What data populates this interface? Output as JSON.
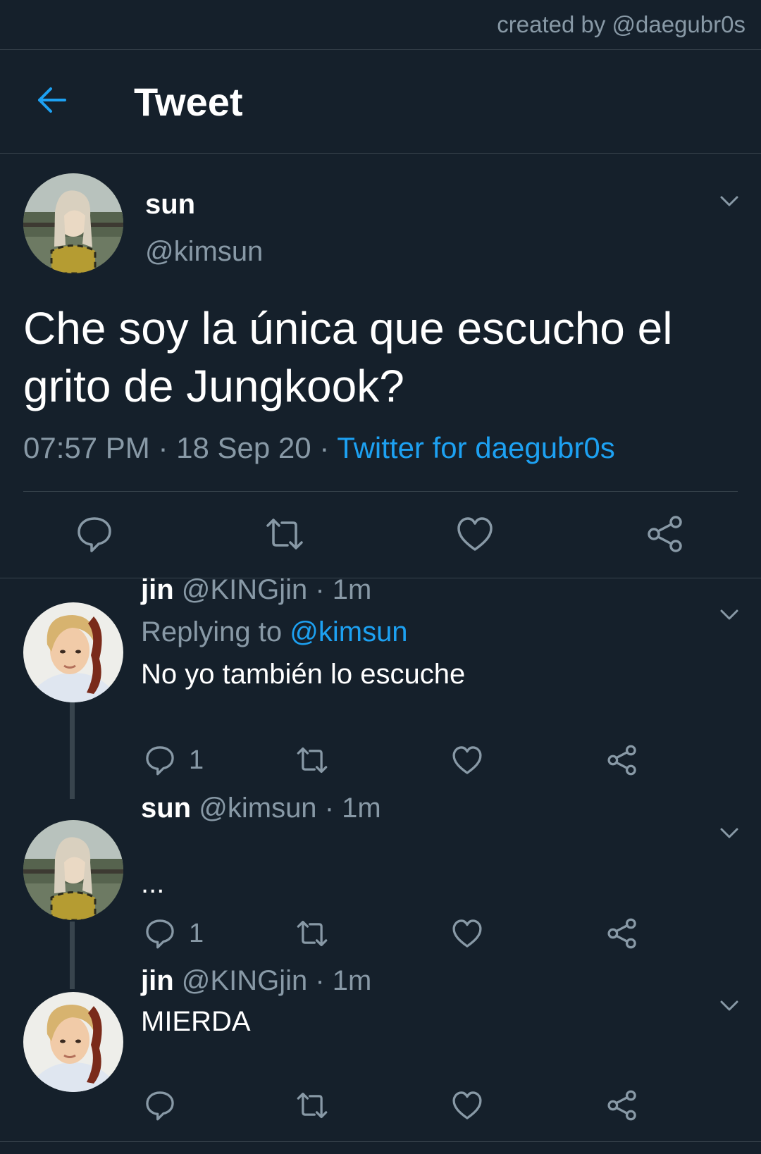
{
  "watermark": "created by @daegubr0s",
  "header": {
    "title": "Tweet"
  },
  "main_tweet": {
    "name": "sun",
    "handle": "@kimsun",
    "text": "Che soy la única que escucho el grito de Jungkook?",
    "time": "07:57 PM",
    "sep1": "·",
    "date": "18 Sep 20",
    "sep2": "·",
    "source": "Twitter for daegubr0s"
  },
  "replies": [
    {
      "name": "jin",
      "handle": "@KINGjin",
      "time": "1m",
      "replying_prefix": "Replying to",
      "replying_to": "@kimsun",
      "text": "No yo también lo escuche",
      "reply_count": "1"
    },
    {
      "name": "sun",
      "handle": "@kimsun",
      "time": "1m",
      "text": "...",
      "reply_count": "1"
    },
    {
      "name": "jin",
      "handle": "@KINGjin",
      "time": "1m",
      "text": "MIERDA",
      "reply_count": ""
    }
  ],
  "colors": {
    "background": "#15202b",
    "accent": "#1da1f2",
    "muted": "#8899a6",
    "divider": "#38444d"
  },
  "icons": [
    "back-arrow-icon",
    "chevron-down-icon",
    "reply-icon",
    "retweet-icon",
    "like-icon",
    "share-icon"
  ]
}
